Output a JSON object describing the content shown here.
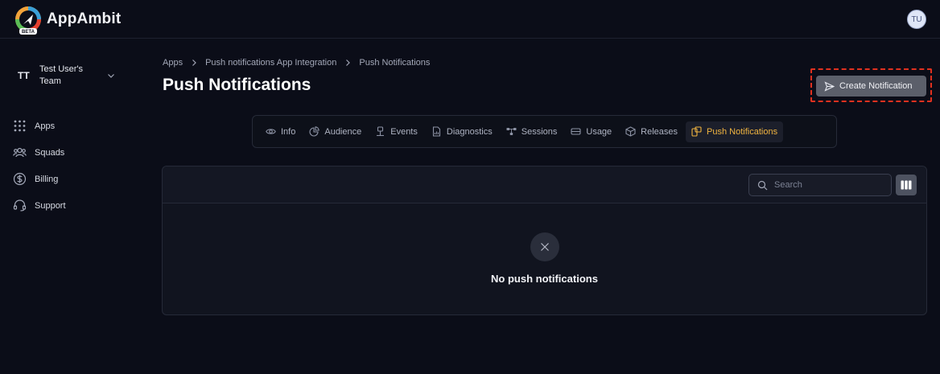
{
  "app": {
    "brand": "AppAmbit",
    "logo_badge": "BETA",
    "user_initials": "TU"
  },
  "team": {
    "initials": "TT",
    "name": "Test User's Team"
  },
  "sidebar": {
    "items": [
      {
        "label": "Apps",
        "icon": "grid-dots-icon"
      },
      {
        "label": "Squads",
        "icon": "users-icon"
      },
      {
        "label": "Billing",
        "icon": "dollar-circle-icon"
      },
      {
        "label": "Support",
        "icon": "headset-icon"
      }
    ]
  },
  "breadcrumb": [
    "Apps",
    "Push notifications App Integration",
    "Push Notifications"
  ],
  "page": {
    "title": "Push Notifications",
    "create_label": "Create Notification"
  },
  "tabs": [
    {
      "label": "Info",
      "icon": "eye-icon"
    },
    {
      "label": "Audience",
      "icon": "pie-chart-icon"
    },
    {
      "label": "Events",
      "icon": "network-icon"
    },
    {
      "label": "Diagnostics",
      "icon": "file-chart-icon"
    },
    {
      "label": "Sessions",
      "icon": "sessions-icon"
    },
    {
      "label": "Usage",
      "icon": "storage-icon"
    },
    {
      "label": "Releases",
      "icon": "box-icon"
    },
    {
      "label": "Push Notifications",
      "icon": "push-icon",
      "active": true
    }
  ],
  "table": {
    "search_placeholder": "Search",
    "empty_message": "No push notifications"
  },
  "colors": {
    "accent": "#f0b440",
    "highlight_border": "#e0311f",
    "background": "#0b0d18"
  }
}
